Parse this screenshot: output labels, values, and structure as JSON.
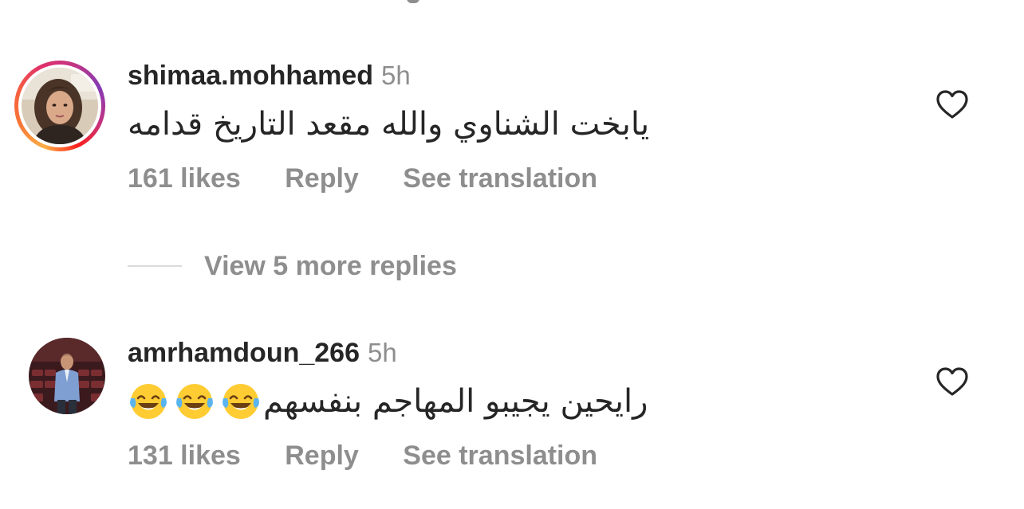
{
  "comments": [
    {
      "username": "shimaa.mohhamed",
      "time": "5h",
      "text": "يابخت الشناوي والله مقعد التاريخ قدامه",
      "likes": "161 likes",
      "reply_label": "Reply",
      "translate_label": "See translation",
      "has_story_ring": true,
      "like_icon": "heart-outline-icon"
    },
    {
      "username": "amrhamdoun_266",
      "time": "5h",
      "text": "رايحين يجيبو المهاجم بنفسهم",
      "emoji": "😂😂😂",
      "emoji_icon": "face-with-tears-of-joy-icon",
      "likes": "131 likes",
      "reply_label": "Reply",
      "translate_label": "See translation",
      "has_story_ring": false,
      "like_icon": "heart-outline-icon"
    }
  ],
  "view_more": {
    "label": "View 5 more replies"
  },
  "colors": {
    "primary_text": "#262626",
    "secondary_text": "#8e8e8e",
    "divider": "#dbdbdb",
    "story_ring": [
      "#fcaf45",
      "#f56040",
      "#e1306c",
      "#c13584",
      "#833ab4"
    ]
  }
}
